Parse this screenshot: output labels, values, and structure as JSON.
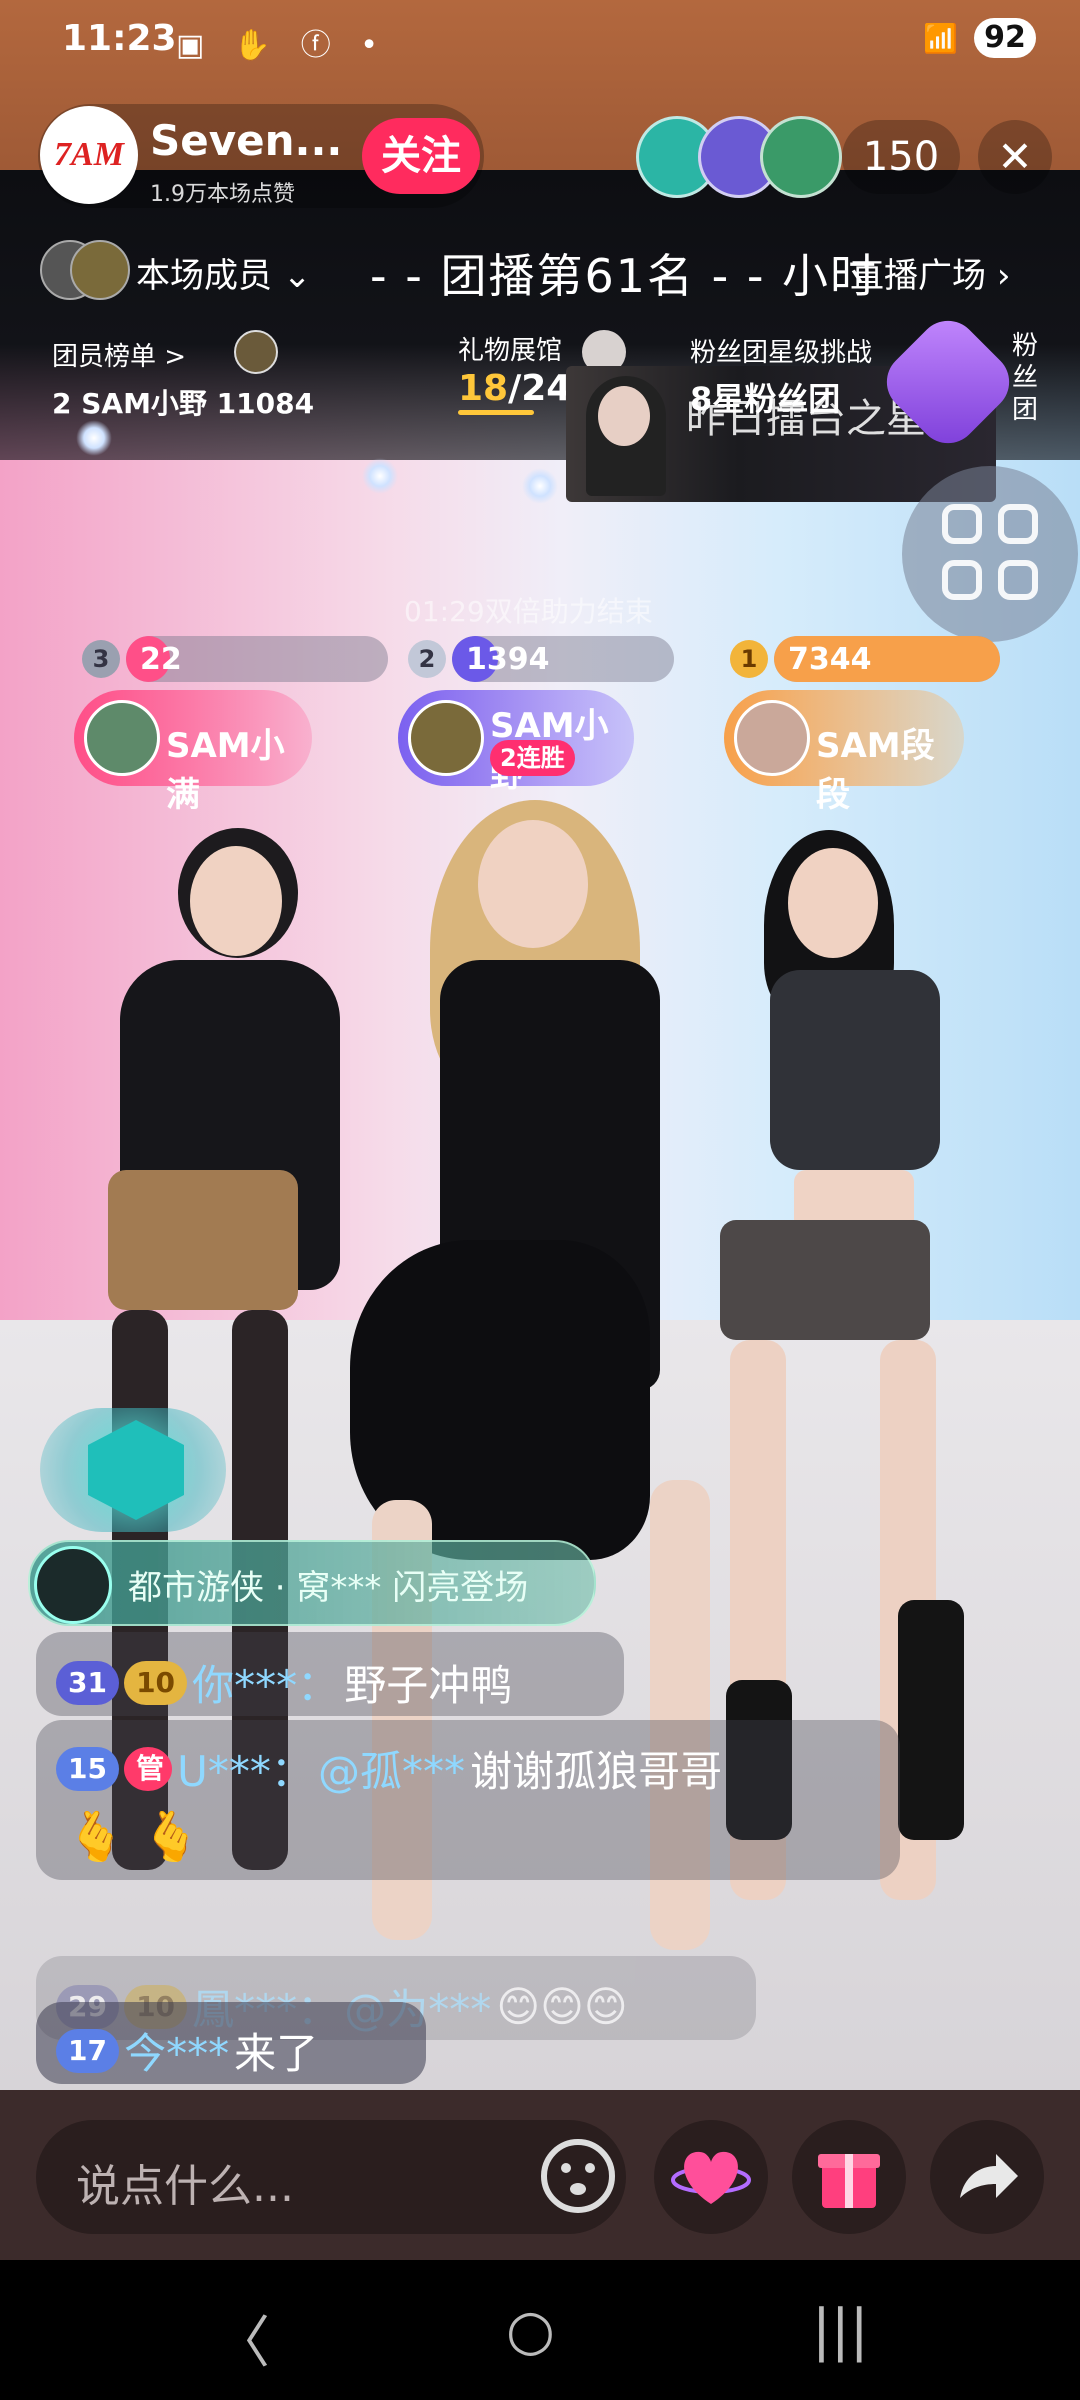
{
  "status": {
    "time": "11:23",
    "left_icons": "▣ ✋ ⓕ •",
    "battery": "92"
  },
  "host": {
    "avatar_text": "7AM",
    "name": "Seven...",
    "likes": "1.9万本场点赞",
    "follow_label": "关注",
    "viewer_count": "150",
    "close_glyph": "✕"
  },
  "members_bar": {
    "label": "本场成员",
    "rank_text": "- - 团播第61名  - - 小时",
    "plaza": "直播广场"
  },
  "stats": {
    "roster_label": "团员榜单 >",
    "roster_value": "2 SAM小野  11084",
    "gift_label": "礼物展馆",
    "gift_progress_num": "18",
    "gift_progress_total": "/24",
    "fan_label": "粉丝团星级挑战",
    "fan_value": "8星粉丝团",
    "banner_text": "昨日擂台之星",
    "fan_vertical": [
      "粉",
      "丝",
      "团"
    ]
  },
  "double_timer": "01:29双倍助力结束",
  "pk": [
    {
      "rank": "3",
      "score": "22",
      "name": "SAM小满",
      "streak": "",
      "fill": 0.08
    },
    {
      "rank": "2",
      "score": "1394",
      "name": "SAM小野",
      "streak": "2连胜",
      "fill": 0.15
    },
    {
      "rank": "1",
      "score": "7344",
      "name": "SAM段段",
      "streak": "",
      "fill": 1.0
    }
  ],
  "entry_banner": {
    "text": "都市游侠 · 窝*** 闪亮登场"
  },
  "chat": [
    {
      "level": "31",
      "fan_level": "10",
      "name": "你***：",
      "msg": "野子冲鸭"
    },
    {
      "level": "15",
      "role": "管",
      "name": "U***：",
      "mention": "@孤***",
      "msg": "谢谢孤狼哥哥",
      "emoji": "🫰 🫰"
    },
    {
      "level": "29",
      "fan_level": "10",
      "name": "鳳***：",
      "mention": "@为***",
      "msg": "😊😊😊"
    },
    {
      "level": "17",
      "name": "今***",
      "msg": "来了"
    }
  ],
  "input": {
    "placeholder": "说点什么..."
  },
  "nav": {
    "back": "〈",
    "home": "○",
    "recents": "|||"
  },
  "colors": {
    "follow": "#ff2b5e",
    "gold": "#ffc73a",
    "chat_name": "#8fd8ff"
  }
}
